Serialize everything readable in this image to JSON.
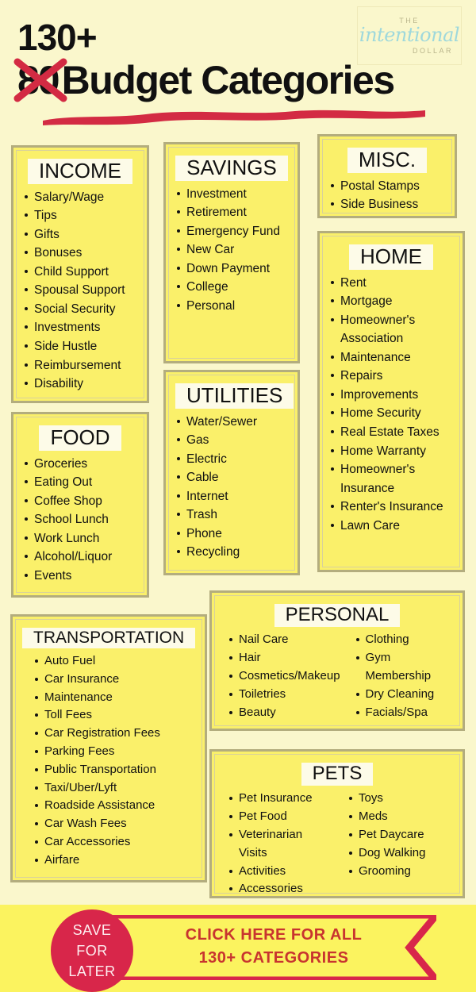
{
  "header": {
    "count": "130+",
    "struck_number": "80",
    "title": "Budget Categories",
    "logo": {
      "top": "THE",
      "word": "intentional",
      "bottom": "DOLLAR"
    }
  },
  "colors": {
    "page_background": "#faf7cc",
    "card_background": "#faf06a",
    "card_border": "#b3ad7e",
    "accent_red": "#d32b43",
    "cta_red": "#d8264a",
    "cta_text_red": "#c8342f",
    "logo_teal": "#9ed8dc",
    "heading_highlight": "#fdfbe8"
  },
  "boxes": {
    "income": {
      "title": "INCOME",
      "items": [
        "Salary/Wage",
        "Tips",
        "Gifts",
        "Bonuses",
        "Child Support",
        "Spousal Support",
        "Social Security",
        "Investments",
        "Side Hustle",
        "Reimbursement",
        "Disability"
      ]
    },
    "food": {
      "title": "FOOD",
      "items": [
        "Groceries",
        "Eating Out",
        "Coffee Shop",
        "School Lunch",
        "Work Lunch",
        "Alcohol/Liquor",
        "Events"
      ]
    },
    "transportation": {
      "title": "TRANSPORTATION",
      "items": [
        "Auto Fuel",
        "Car Insurance",
        "Maintenance",
        "Toll Fees",
        "Car Registration Fees",
        "Parking Fees",
        "Public Transportation",
        "Taxi/Uber/Lyft",
        "Roadside Assistance",
        "Car Wash Fees",
        "Car Accessories",
        "Airfare"
      ]
    },
    "savings": {
      "title": "SAVINGS",
      "items": [
        "Investment",
        "Retirement",
        "Emergency Fund",
        "New Car",
        "Down Payment",
        "College",
        "Personal"
      ]
    },
    "utilities": {
      "title": "UTILITIES",
      "items": [
        "Water/Sewer",
        "Gas",
        "Electric",
        "Cable",
        "Internet",
        "Trash",
        "Phone",
        "Recycling"
      ]
    },
    "misc": {
      "title": "MISC.",
      "items": [
        "Postal Stamps",
        "Side Business"
      ]
    },
    "home": {
      "title": "HOME",
      "items": [
        "Rent",
        "Mortgage",
        "Homeowner's Association",
        "Maintenance",
        "Repairs",
        "Improvements",
        "Home Security",
        "Real Estate Taxes",
        "Home Warranty",
        "Homeowner's Insurance",
        "Renter's Insurance",
        "Lawn Care"
      ]
    },
    "personal": {
      "title": "PERSONAL",
      "items_left": [
        "Nail Care",
        "Hair",
        "Cosmetics/Makeup",
        "Toiletries",
        "Beauty"
      ],
      "items_right": [
        "Clothing",
        "Gym Membership",
        "Dry Cleaning",
        "Facials/Spa"
      ]
    },
    "pets": {
      "title": "PETS",
      "items_left": [
        "Pet Insurance",
        "Pet Food",
        "Veterinarian Visits",
        "Activities",
        "Accessories"
      ],
      "items_right": [
        "Toys",
        "Meds",
        "Pet Daycare",
        "Dog Walking",
        "Grooming"
      ]
    }
  },
  "cta": {
    "circle_line1": "SAVE",
    "circle_line2": "FOR",
    "circle_line3": "LATER",
    "banner_line1": "CLICK HERE FOR ALL",
    "banner_line2": "130+ CATEGORIES"
  }
}
